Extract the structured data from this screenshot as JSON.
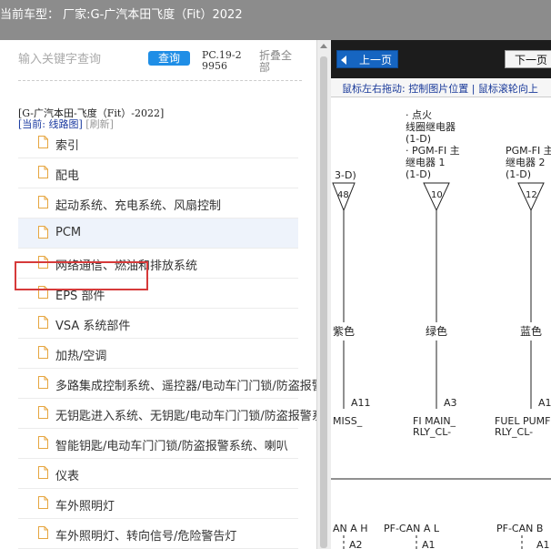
{
  "header": {
    "title": "当前车型： 厂家:G-广汽本田飞度（Fit）2022"
  },
  "left_panel": {
    "search_placeholder": "输入关键字查询",
    "query_button": "查询",
    "pc_code": "PC.19-29956",
    "collapse_all": "折叠全部",
    "model_line": "[G-广汽本田-飞度（Fit）-2022]",
    "current_label": "[当前: 线路图]",
    "refresh_label": "[刷新]",
    "items": [
      {
        "label": "索引"
      },
      {
        "label": "配电"
      },
      {
        "label": "起动系统、充电系统、风扇控制"
      },
      {
        "label": "PCM",
        "selected": true
      },
      {
        "label": "网络通信、燃油和排放系统"
      },
      {
        "label": "EPS 部件"
      },
      {
        "label": "VSA 系统部件"
      },
      {
        "label": "加热/空调"
      },
      {
        "label": "多路集成控制系统、遥控器/电动车门门锁/防盗报警"
      },
      {
        "label": "无钥匙进入系统、无钥匙/电动车门门锁/防盗报警系"
      },
      {
        "label": "智能钥匙/电动车门门锁/防盗报警系统、喇叭"
      },
      {
        "label": "仪表"
      },
      {
        "label": "车外照明灯"
      },
      {
        "label": "车外照明灯、转向信号/危险警告灯"
      }
    ]
  },
  "viewer": {
    "prev_button": "上一页",
    "next_button": "下一页",
    "hint": "鼠标左右拖动: 控制图片位置 | 鼠标滚轮向上",
    "diagram": {
      "left_partial": "3-D)",
      "col1_title": [
        "· 点火",
        "线圈继电器",
        "(1-D)",
        "· PGM-FI 主",
        "继电器 1",
        "(1-D)"
      ],
      "col2_title": [
        "PGM-FI 主",
        "继电器 2",
        "(1-D)"
      ],
      "pins": [
        "48",
        "10",
        "12"
      ],
      "wire_colors": [
        "紫色",
        "绿色",
        "蓝色"
      ],
      "terminals": [
        "A11",
        "A3",
        "A1"
      ],
      "signals_left": "MISS_",
      "signals_mid": [
        "FI MAIN_",
        "RLY_CL-"
      ],
      "signals_right": [
        "FUEL PUMF",
        "RLY_CL-"
      ],
      "bottom_labels": [
        "AN A H",
        "PF-CAN A L",
        "PF-CAN B"
      ],
      "bottom_terms": [
        "A2",
        "A1",
        "A1"
      ]
    }
  }
}
